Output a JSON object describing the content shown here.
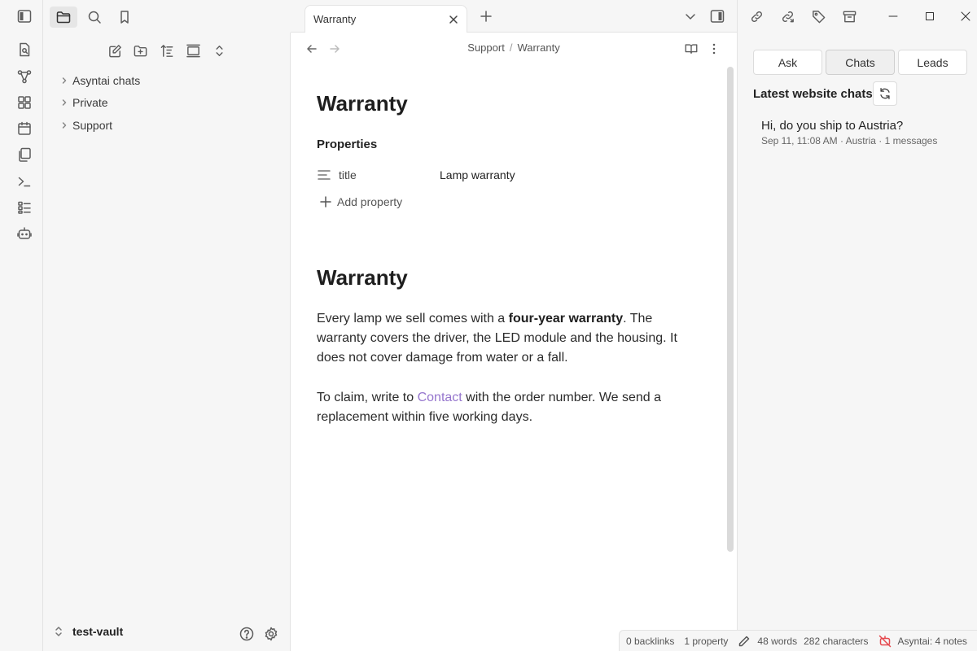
{
  "ribbon": {
    "icons": [
      "sidebar-toggle-icon",
      "open-quick-switcher-icon",
      "graph-view-icon",
      "canvas-icon",
      "daily-note-icon",
      "templates-icon",
      "command-palette-icon",
      "bases-icon",
      "asyntai-bot-icon"
    ]
  },
  "left_top": {
    "icons": [
      "folder-icon",
      "search-icon",
      "bookmark-icon"
    ],
    "active": "folder-icon"
  },
  "explorer": {
    "nav_icons": [
      "new-note-icon",
      "new-folder-icon",
      "sort-icon",
      "auto-reveal-icon",
      "collapse-all-icon"
    ],
    "items": [
      {
        "label": "Asyntai chats"
      },
      {
        "label": "Private"
      },
      {
        "label": "Support"
      }
    ]
  },
  "vault": {
    "name": "test-vault",
    "icons": [
      "help-icon",
      "settings-icon"
    ]
  },
  "tabbar": {
    "tab_title": "Warranty",
    "icons": [
      "new-tab-icon",
      "tab-list-icon",
      "right-sidebar-toggle-icon"
    ]
  },
  "view_header": {
    "breadcrumb": [
      "Support",
      "Warranty"
    ],
    "separator": "/",
    "icons": [
      "back-icon",
      "forward-icon",
      "reading-view-icon",
      "more-options-icon"
    ]
  },
  "editor": {
    "inline_title": "Warranty",
    "properties_heading": "Properties",
    "property": {
      "key": "title",
      "value": "Lamp warranty",
      "type_icon": "text-lines-icon"
    },
    "add_property": "Add property",
    "heading": "Warranty",
    "para1": {
      "before": "Every lamp we sell comes with a ",
      "bold": "four-year warranty",
      "after": ". The warranty covers the driver, the LED module and the housing. It does not cover damage from water or a fall."
    },
    "para2": {
      "before": "To claim, write to ",
      "link": "Contact",
      "after": " with the order number. We send a replacement within five working days."
    }
  },
  "status_bar": {
    "backlinks": "0 backlinks",
    "properties": "1 property",
    "words": "48 words",
    "characters": "282 characters",
    "asyntai": "Asyntai: 4 notes",
    "colors": {
      "asyntai_icon": "#e5484d"
    }
  },
  "right_top": {
    "icons": [
      "link-icon",
      "share-icon",
      "tag-icon",
      "archive-icon"
    ],
    "window": [
      "minimize-icon",
      "maximize-icon",
      "close-window-icon"
    ]
  },
  "right_panel": {
    "tabs": [
      {
        "label": "Ask",
        "active": false
      },
      {
        "label": "Chats",
        "active": true
      },
      {
        "label": "Leads",
        "active": false
      }
    ],
    "title": "Latest website chats",
    "chats": [
      {
        "question": "Hi, do you ship to Austria?",
        "meta": "Sep 11, 11:08 AM · Austria · 1 messages"
      }
    ]
  },
  "colors": {
    "accent_link": "#9575cd",
    "sidebar_bg": "#f6f6f6",
    "border": "#e3e3e3"
  }
}
